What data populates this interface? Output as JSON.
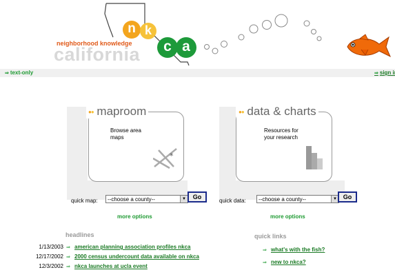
{
  "logo": {
    "letters": [
      "n",
      "k",
      "c",
      "a"
    ],
    "tagline": "neighborhood knowledge",
    "wordmark": "california"
  },
  "nav": {
    "text_only": "text-only",
    "sign_in": "sign in"
  },
  "maproom": {
    "title": "maproom",
    "description": "Browse area maps",
    "quick_label": "quick map:",
    "select_value": "--choose a county--",
    "go_label": "Go",
    "more": "more options"
  },
  "data_charts": {
    "title": "data & charts",
    "description": "Resources for your research",
    "quick_label": "quick data:",
    "select_value": "--choose a county--",
    "go_label": "Go",
    "more": "more options"
  },
  "headlines": {
    "heading": "headlines",
    "items": [
      {
        "date": "1/13/2003",
        "title": "american planning association profiles nkca"
      },
      {
        "date": "12/17/2002",
        "title": "2000 census undercount data available on nkca"
      },
      {
        "date": "12/3/2002",
        "title": "nkca launches at ucla event"
      }
    ]
  },
  "quick_links": {
    "heading": "quick links",
    "items": [
      "what's with the fish?",
      "new to nkca?"
    ]
  },
  "colors": {
    "green": "#1e9a32",
    "orange": "#f3a51e",
    "yellow": "#f6c23a",
    "logo_green": "#1d9a3a",
    "fish": "#f06a0a"
  },
  "icons": [
    "arrow-icon",
    "fish-icon",
    "bubble-icon",
    "california-outline-icon"
  ]
}
